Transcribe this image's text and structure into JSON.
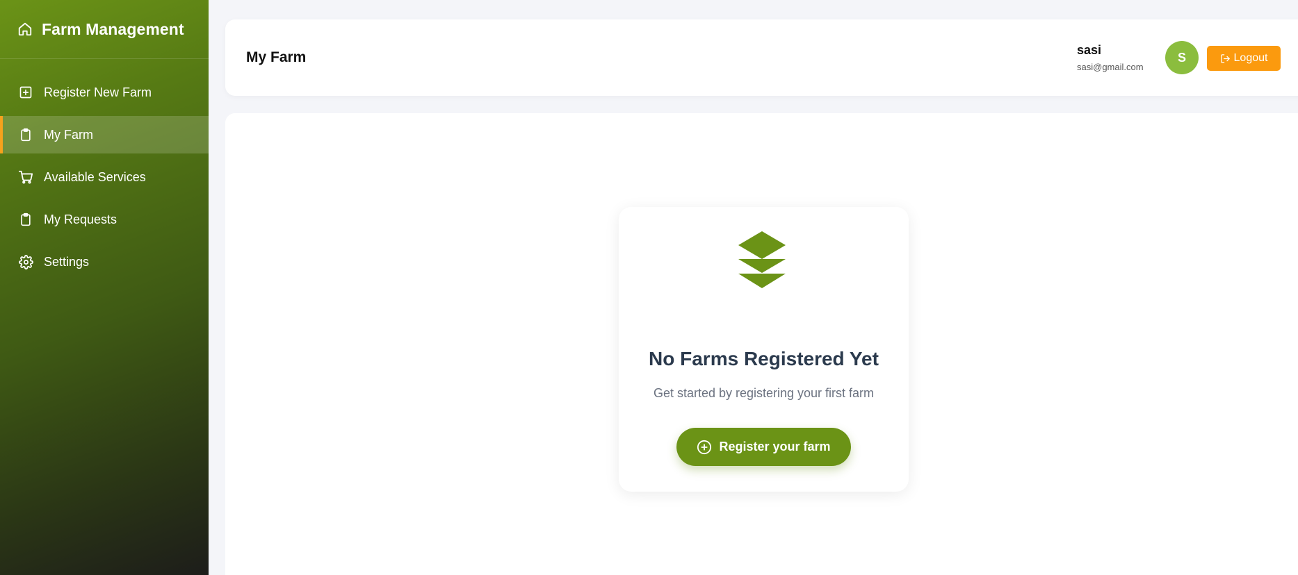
{
  "sidebar": {
    "brand": {
      "title": "Farm Management",
      "icon": "home-icon"
    },
    "items": [
      {
        "label": "Register New Farm",
        "icon": "plus-square-icon",
        "active": false
      },
      {
        "label": "My Farm",
        "icon": "clipboard-icon",
        "active": true
      },
      {
        "label": "Available Services",
        "icon": "cart-icon",
        "active": false
      },
      {
        "label": "My Requests",
        "icon": "clipboard-icon",
        "active": false
      },
      {
        "label": "Settings",
        "icon": "gear-icon",
        "active": false
      }
    ]
  },
  "header": {
    "title": "My Farm",
    "user": {
      "name": "sasi",
      "email": "sasi@gmail.com",
      "avatar_initial": "S"
    },
    "logout_label": "Logout",
    "logout_icon": "logout-icon"
  },
  "empty_state": {
    "icon": "layers-icon",
    "title": "No Farms Registered Yet",
    "subtitle": "Get started by registering your first farm",
    "button_label": "Register your farm",
    "button_icon": "plus-circle-icon"
  },
  "colors": {
    "primary_green": "#6b9316",
    "accent_orange": "#fb9a0e",
    "avatar_green": "#8bbd3e",
    "active_indicator": "#f6a21c"
  }
}
